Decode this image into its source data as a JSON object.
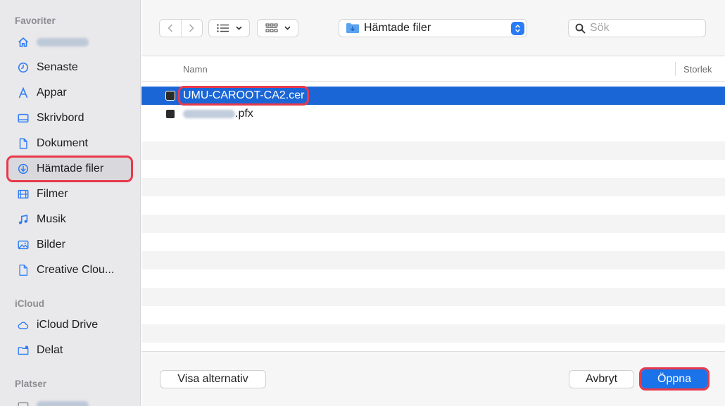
{
  "sidebar": {
    "sections": {
      "favorites": "Favoriter",
      "icloud": "iCloud",
      "places": "Platser"
    },
    "items": [
      {
        "id": "home",
        "label": ""
      },
      {
        "id": "recent",
        "label": "Senaste"
      },
      {
        "id": "apps",
        "label": "Appar"
      },
      {
        "id": "desktop",
        "label": "Skrivbord"
      },
      {
        "id": "documents",
        "label": "Dokument"
      },
      {
        "id": "downloads",
        "label": "Hämtade filer"
      },
      {
        "id": "movies",
        "label": "Filmer"
      },
      {
        "id": "music",
        "label": "Musik"
      },
      {
        "id": "pictures",
        "label": "Bilder"
      },
      {
        "id": "creative",
        "label": "Creative Clou..."
      },
      {
        "id": "icloud-drive",
        "label": "iCloud Drive"
      },
      {
        "id": "shared",
        "label": "Delat"
      }
    ]
  },
  "toolbar": {
    "location": "Hämtade filer",
    "search_placeholder": "Sök"
  },
  "list": {
    "columns": {
      "name": "Namn",
      "size": "Storlek"
    },
    "files": [
      {
        "name": "UMU-CAROOT-CA2.cer",
        "selected": true
      },
      {
        "name": ".pfx",
        "selected": false
      }
    ]
  },
  "buttons": {
    "options": "Visa alternativ",
    "cancel": "Avbryt",
    "open": "Öppna"
  },
  "colors": {
    "accent": "#1a73e8",
    "selection": "#1b66d6",
    "highlight": "#e8394a"
  }
}
